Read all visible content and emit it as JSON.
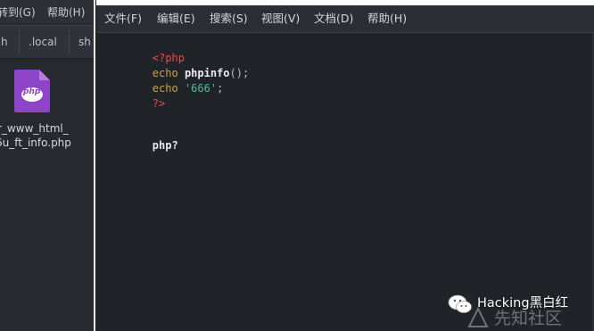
{
  "file_manager": {
    "menu": [
      "转到(G)",
      "帮助(H)"
    ],
    "tabs": [
      "h",
      ".local",
      "sh"
    ],
    "file": {
      "icon_label": "php",
      "name_line1": "r_www_html_",
      "name_line2": "6u_ft_info.php"
    }
  },
  "editor": {
    "menu": [
      "文件(F)",
      "编辑(E)",
      "搜索(S)",
      "视图(V)",
      "文档(D)",
      "帮助(H)"
    ],
    "code": {
      "line1": "<?php",
      "line2_kw": "echo",
      "line2_fn": "phpinfo",
      "line2_punc": "();",
      "line3_kw": "echo",
      "line3_str": "'666'",
      "line3_punc": ";",
      "line4": "?>",
      "line7": "php?"
    }
  },
  "watermark": {
    "text": "Hacking黑白红",
    "logo_text": "先知社区"
  },
  "colors": {
    "php_tag": "#e84a4a",
    "keyword": "#c9a14a",
    "string": "#4bbf9a",
    "php_file_icon": "#8e44c9"
  }
}
